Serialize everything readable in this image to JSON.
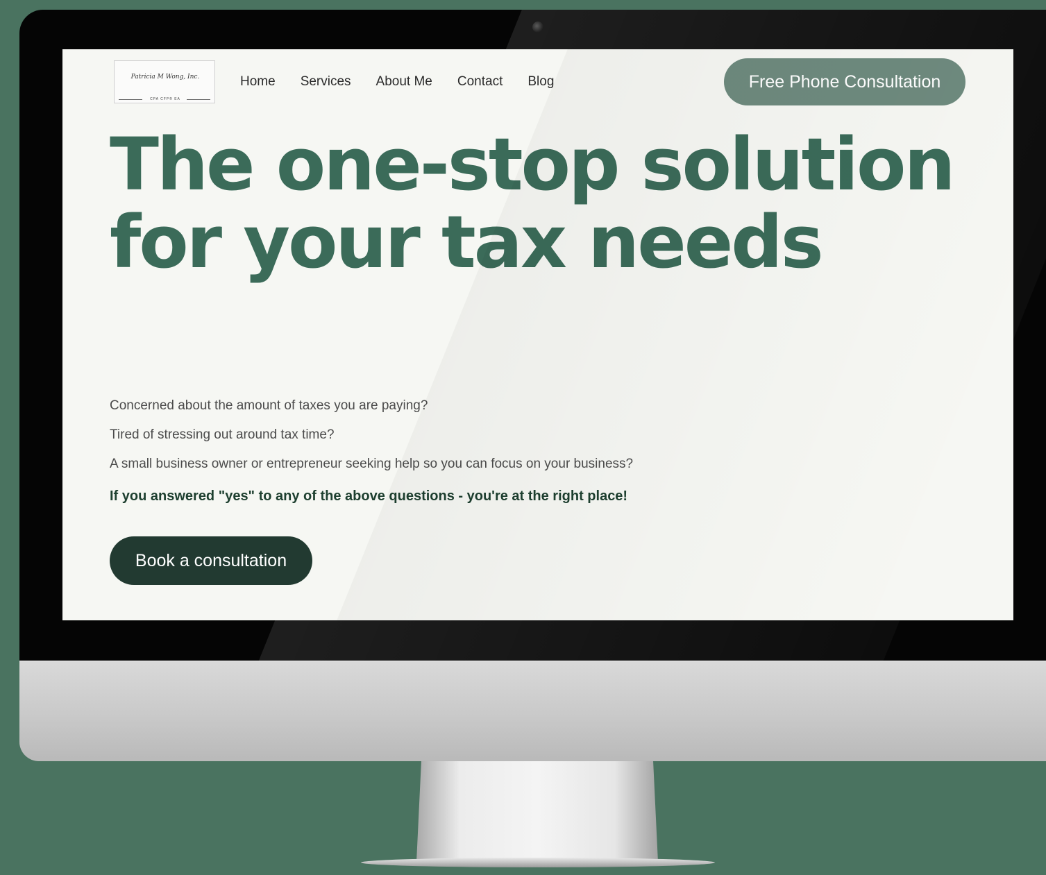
{
  "site": {
    "logo": {
      "script_text": "Patricia M Wong, Inc.",
      "sub_text": "CPA CFP® EA"
    },
    "nav": [
      "Home",
      "Services",
      "About Me",
      "Contact",
      "Blog"
    ],
    "header_cta": "Free Phone Consultation",
    "hero_title": "The one-stop solution for your tax needs",
    "questions": [
      "Concerned about the amount of taxes you are paying?",
      "Tired of stressing out around tax time?",
      "A small business owner or entrepreneur seeking help so you can focus on your business?"
    ],
    "closing_line": "If you answered \"yes\" to any of the above questions - you're at the right place!",
    "book_cta": "Book a consultation"
  },
  "colors": {
    "background": "#4a7360",
    "hero_text": "#3b6b59",
    "header_button": "#6e8a7e",
    "book_button": "#223a31",
    "closing_text": "#1d3f2f"
  }
}
